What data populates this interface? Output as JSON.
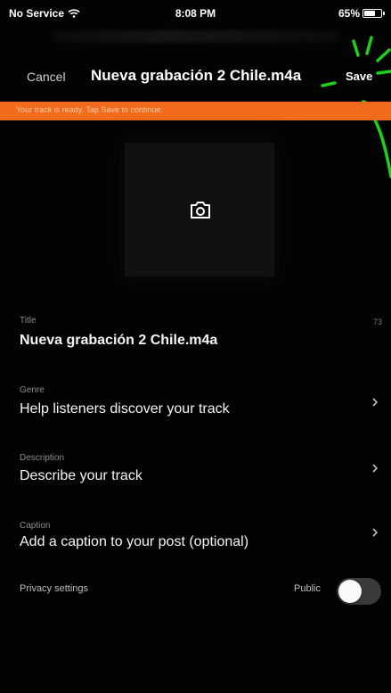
{
  "status_bar": {
    "carrier": "No Service",
    "time": "8:08 PM",
    "battery_percent": "65%",
    "battery_level": 0.65
  },
  "nav": {
    "cancel_label": "Cancel",
    "title": "Nueva grabación 2 Chile.m4a",
    "save_label": "Save"
  },
  "banner": {
    "text": "Your track is ready. Tap Save to continue.",
    "color": "#f26a1b"
  },
  "artwork": {
    "icon": "camera-icon"
  },
  "fields": {
    "title": {
      "label": "Title",
      "value": "Nueva grabación 2 Chile.m4a",
      "count": "73"
    },
    "genre": {
      "label": "Genre",
      "value": "Help listeners discover your track"
    },
    "description": {
      "label": "Description",
      "value": "Describe your track"
    },
    "caption": {
      "label": "Caption",
      "value": "Add a caption to your post (optional)"
    }
  },
  "privacy": {
    "label": "Privacy settings",
    "state_label": "Public",
    "toggle_on": false
  },
  "colors": {
    "accent_orange": "#f26a1b",
    "annotation_green": "#1ed01e"
  }
}
